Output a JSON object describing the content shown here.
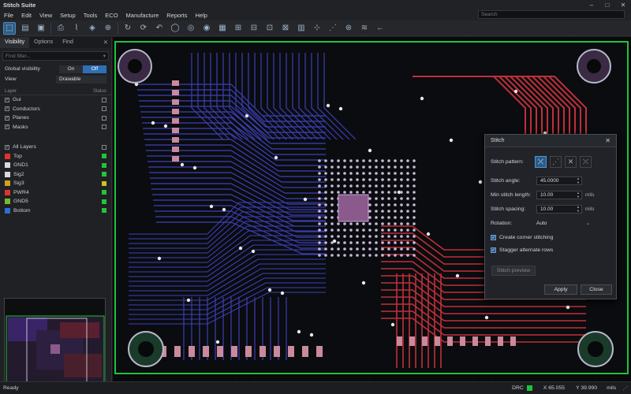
{
  "window": {
    "title": "Stitch Suite"
  },
  "menu": [
    "File",
    "Edit",
    "View",
    "Setup",
    "Tools",
    "ECO",
    "Manufacture",
    "Reports",
    "Help"
  ],
  "search": {
    "placeholder": "Search"
  },
  "panel": {
    "tabs": [
      "Visibility",
      "Options",
      "Find"
    ],
    "filter_placeholder": "Find filter...",
    "global_visibility": {
      "label": "Global visibility",
      "on": "On",
      "off": "Off"
    },
    "view": {
      "label": "View",
      "value": "Drawable"
    },
    "layer_header": {
      "layer": "Layer",
      "status": "Status"
    },
    "groups": [
      {
        "label": "Gui"
      },
      {
        "label": "Conductors"
      },
      {
        "label": "Planes"
      },
      {
        "label": "Masks"
      }
    ],
    "all_layers": "All Layers",
    "layers": [
      {
        "label": "Top",
        "color": "#e0332f",
        "status_color": "#21c43a"
      },
      {
        "label": "GND1",
        "color": "#d9d9d9",
        "status_color": "#21c43a"
      },
      {
        "label": "Sig2",
        "color": "#d9d9d9",
        "status_color": "#21c43a"
      },
      {
        "label": "Sig3",
        "color": "#d0a020",
        "status_color": "#d0c020"
      },
      {
        "label": "PWR4",
        "color": "#e0332f",
        "status_color": "#21c43a"
      },
      {
        "label": "GND5",
        "color": "#7ab82c",
        "status_color": "#21c43a"
      },
      {
        "label": "Bottom",
        "color": "#2a6fd6",
        "status_color": "#21c43a"
      }
    ]
  },
  "dialog": {
    "title": "Stitch",
    "pattern_label": "Stitch pattern:",
    "angle": {
      "label": "Stitch angle:",
      "value": "45.0000"
    },
    "min_length": {
      "label": "Min stitch length:",
      "value": "10.00",
      "unit": "mils"
    },
    "spacing": {
      "label": "Stitch spacing:",
      "value": "10.00",
      "unit": "mils"
    },
    "rotation": {
      "label": "Rotation:",
      "value": "Auto"
    },
    "corner": "Create corner stitching",
    "stagger": "Stagger alternate rows",
    "preview": "Stitch preview",
    "apply": "Apply",
    "close": "Close"
  },
  "status": {
    "ready": "Ready",
    "drc": "DRC",
    "x": "X 65.055",
    "y": "Y 39.990",
    "unit": "mils"
  },
  "colors": {
    "accent": "#2f6fb3",
    "trace_blue": "#3d3fb8",
    "trace_red": "#c0303a",
    "pad_pink": "#c98a9c",
    "board_green": "#1cc43a"
  }
}
